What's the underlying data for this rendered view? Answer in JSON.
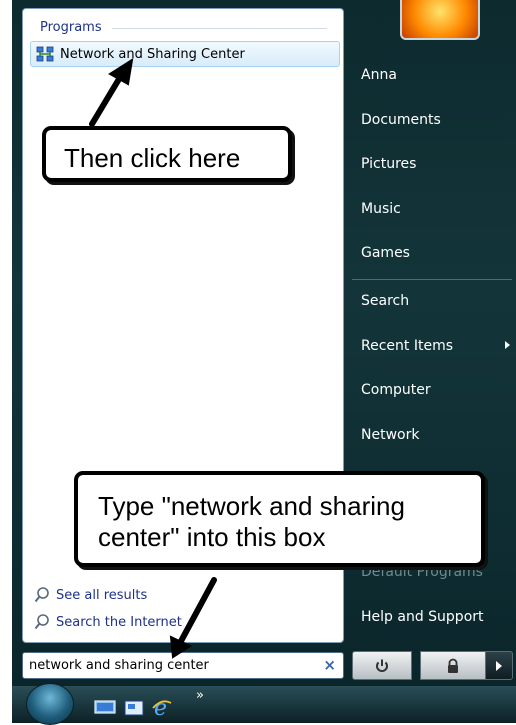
{
  "start_menu": {
    "programs_header": "Programs",
    "program_result": "Network and Sharing Center",
    "see_all_results": "See all results",
    "search_internet": "Search the Internet",
    "search_query": "network and sharing center",
    "search_clear": "×",
    "right_items": [
      "Anna",
      "Documents",
      "Pictures",
      "Music",
      "Games",
      "Search",
      "Recent Items",
      "Computer",
      "Network",
      "Help and Support"
    ],
    "obscured_item": "Default Programs"
  },
  "annotations": {
    "callout_top": "Then click here",
    "callout_bottom": "Type \"network and sharing center\" into this box"
  },
  "taskbar": {
    "overflow": "»"
  },
  "colors": {
    "link_blue": "#1e3287",
    "pane_bg": "#13353a",
    "highlight": "#d7ecfa"
  }
}
